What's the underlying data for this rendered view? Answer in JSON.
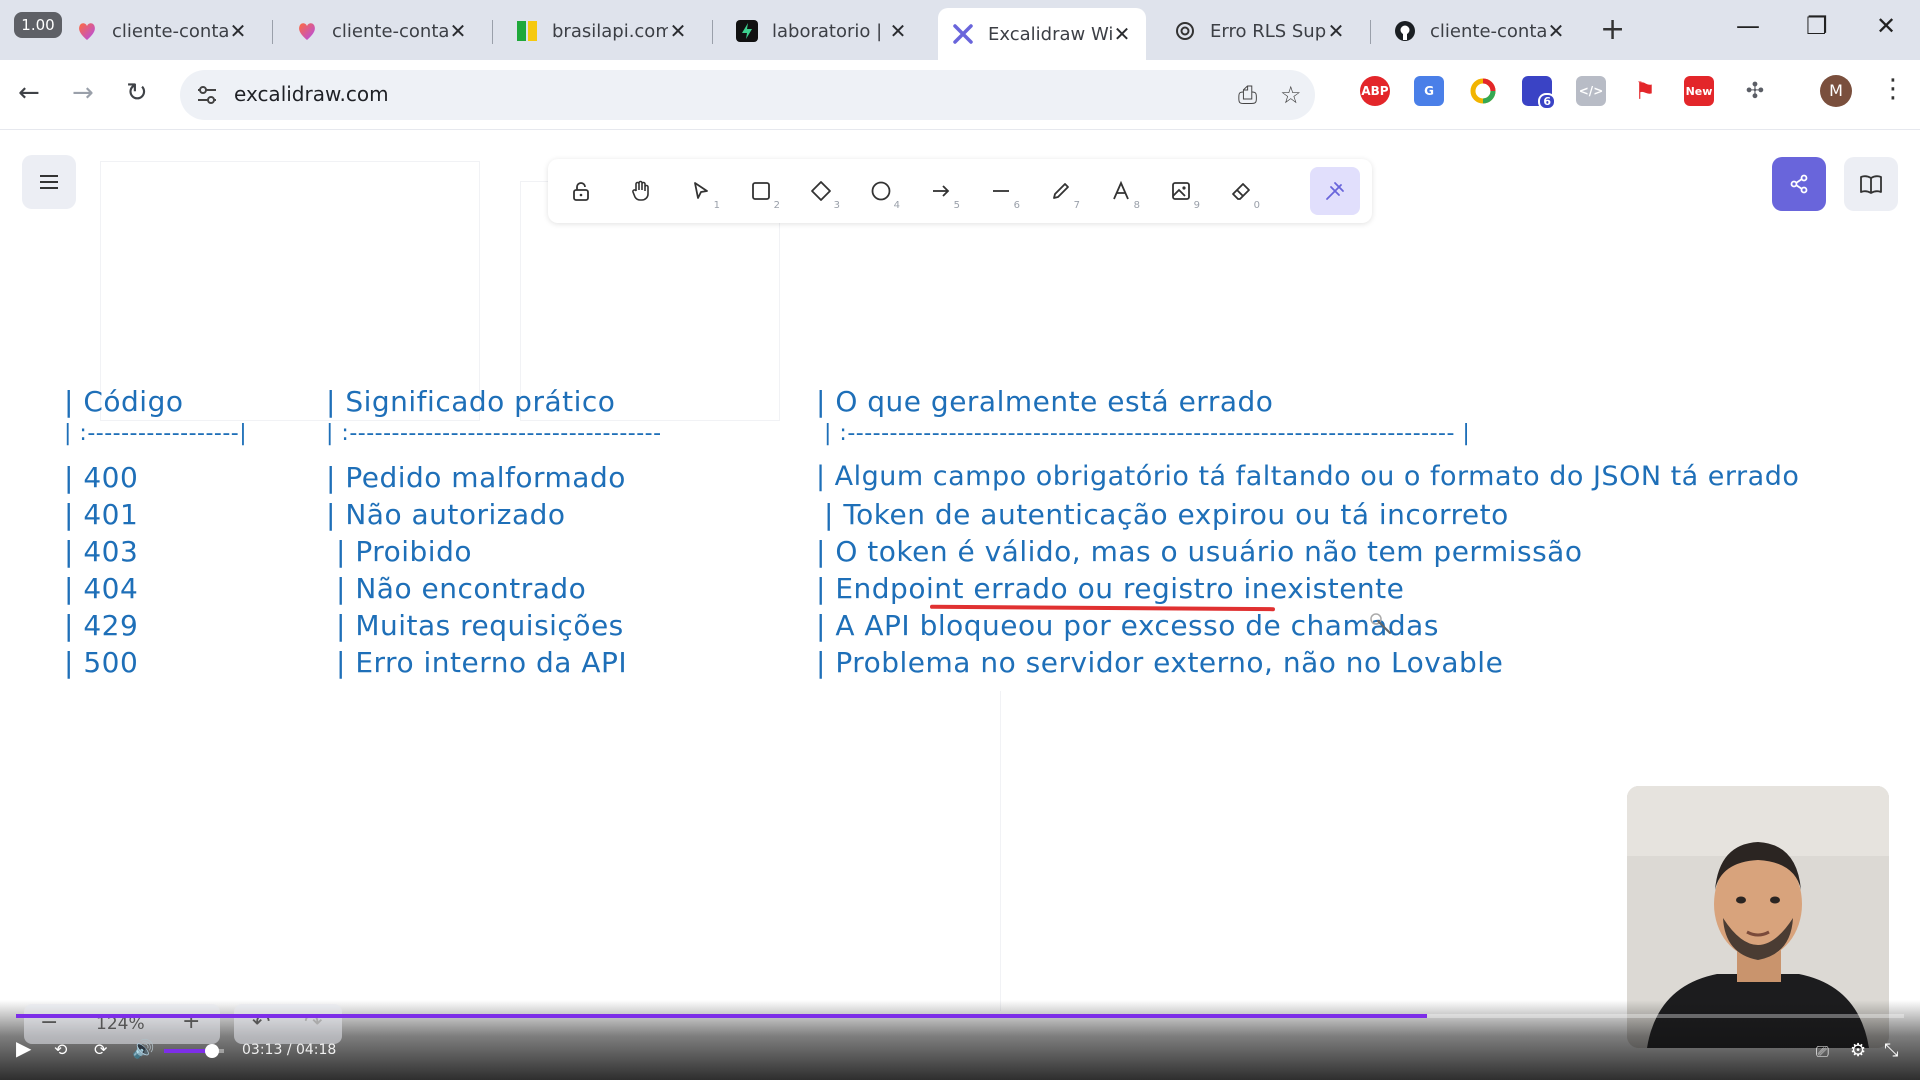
{
  "browser": {
    "speed_badge": "1.00",
    "tabs": [
      {
        "title": "cliente-conta-",
        "icon": "lovable-icon",
        "active": false
      },
      {
        "title": "cliente-conta-",
        "icon": "lovable-icon",
        "active": false
      },
      {
        "title": "brasilapi.com.",
        "icon": "brasilapi-icon",
        "active": false
      },
      {
        "title": "laboratorio | C",
        "icon": "supabase-icon",
        "active": false
      },
      {
        "title": "Excalidraw Wi",
        "icon": "excalidraw-icon",
        "active": true
      },
      {
        "title": "Erro RLS Supa",
        "icon": "chatgpt-icon",
        "active": false
      },
      {
        "title": "cliente-conta-",
        "icon": "github-icon",
        "active": false
      }
    ],
    "url": "excalidraw.com",
    "profile_initial": "M",
    "extensions": [
      {
        "name": "adblock-plus-icon",
        "label": "ABP",
        "color": "#e3262a"
      },
      {
        "name": "translate-icon",
        "label": "G",
        "color": "#4a7fe8"
      },
      {
        "name": "color-ring-icon",
        "label": "",
        "color": "#f2b400"
      },
      {
        "name": "extension-badge-icon",
        "label": "6",
        "color": "#3a43c5"
      },
      {
        "name": "code-icon",
        "label": "</>",
        "color": "#b8bcc6"
      },
      {
        "name": "pin-red-icon",
        "label": "",
        "color": "#e3262a"
      },
      {
        "name": "new-badge-icon",
        "label": "New",
        "color": "#e3262a"
      },
      {
        "name": "puzzle-icon",
        "label": "",
        "color": "#5b5e66"
      }
    ]
  },
  "excalidraw": {
    "tool_numbers": [
      "",
      "",
      "1",
      "2",
      "3",
      "4",
      "5",
      "6",
      "7",
      "8",
      "9",
      "0",
      ""
    ],
    "table_lines": [
      [
        "| Código",
        "| Significado prático",
        "| O que geralmente está errado"
      ],
      [
        "| :------------------|",
        "| :-------------------------------------",
        "| :------------------------------------------------------------------------ |"
      ],
      [
        "| 400",
        "| Pedido malformado",
        "| Algum campo obrigatório tá faltando ou o formato do JSON tá errado"
      ],
      [
        "| 401",
        "| Não autorizado",
        "| Token de autenticação expirou ou tá incorreto"
      ],
      [
        "| 403",
        "| Proibido",
        "| O token é válido, mas o usuário não tem permissão"
      ],
      [
        "| 404",
        "| Não encontrado",
        "| Endpoint errado ou registro inexistente"
      ],
      [
        "| 429",
        "| Muitas requisições",
        "| A API bloqueou por excesso de chamadas"
      ],
      [
        "| 500",
        "| Erro interno da API",
        "| Problema no servidor externo, não no Lovable"
      ]
    ],
    "zoom": "124%",
    "colors": {
      "ink": "#1e6fb8",
      "underline": "#e03131",
      "accent": "#6965db"
    }
  },
  "player": {
    "time_current": "03:13",
    "time_total": "04:18",
    "progress_fraction": 0.7475,
    "volume_fraction": 0.8,
    "accent": "#7d2ee8"
  }
}
